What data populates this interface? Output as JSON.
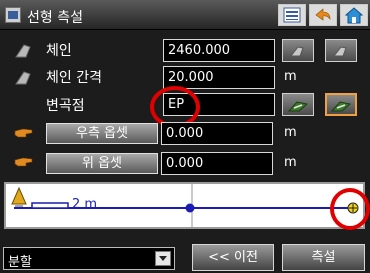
{
  "window": {
    "title": "선형 측설"
  },
  "toolbar": {
    "list_icon": "list-icon",
    "back_icon": "back-arrow-icon",
    "home_icon": "home-icon"
  },
  "rows": {
    "chain": {
      "label": "체인",
      "value": "2460.000"
    },
    "interval": {
      "label": "체인 간격",
      "value": "20.000",
      "unit": "m"
    },
    "point": {
      "label": "변곡점",
      "value": "EP"
    },
    "right_offset": {
      "button": "우측 옵셋",
      "value": "0.000",
      "unit": "m"
    },
    "up_offset": {
      "button": "위 옵셋",
      "value": "0.000",
      "unit": "m"
    }
  },
  "diagram": {
    "scale_label": "2 m",
    "line_color": "#1c1cb4"
  },
  "bottom": {
    "select_value": "분할",
    "prev_label": "<< 이전",
    "stakeout_label": "측설"
  },
  "colors": {
    "accent_orange": "#f0a040",
    "highlight_red": "#e00000"
  }
}
